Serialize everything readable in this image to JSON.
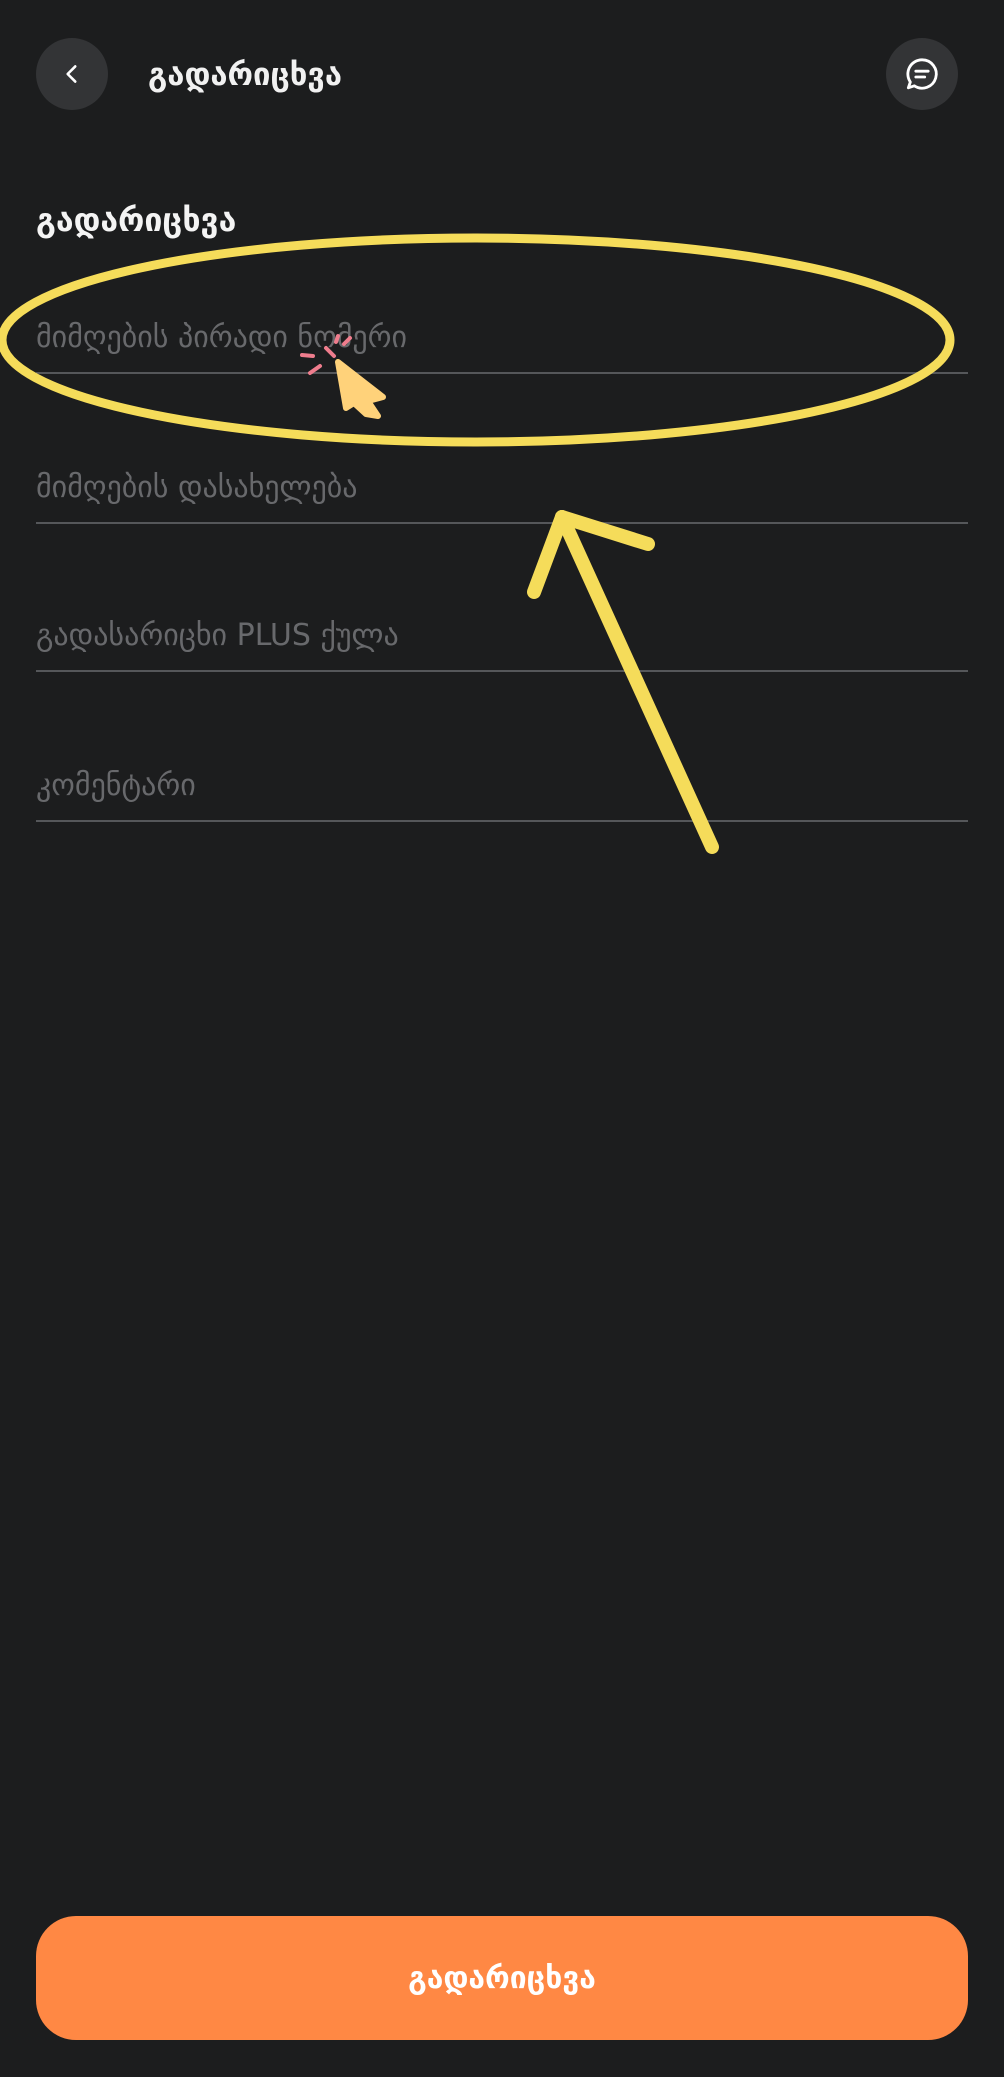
{
  "header": {
    "title": "გადარიცხვა",
    "back_icon": "chevron-left-icon",
    "chat_icon": "chat-bubble-icon"
  },
  "form": {
    "section_title": "გადარიცხვა",
    "fields": [
      {
        "placeholder": "მიმღების პირადი ნომერი",
        "value": ""
      },
      {
        "placeholder": "მიმღების დასახელება",
        "value": ""
      },
      {
        "placeholder": "გადასარიცხი PLUS ქულა",
        "value": ""
      },
      {
        "placeholder": "კომენტარი",
        "value": ""
      }
    ]
  },
  "submit_label": "გადარიცხვა",
  "colors": {
    "background": "#1c1d1e",
    "accent": "#ff8844",
    "annotation": "#f5dc5a"
  }
}
